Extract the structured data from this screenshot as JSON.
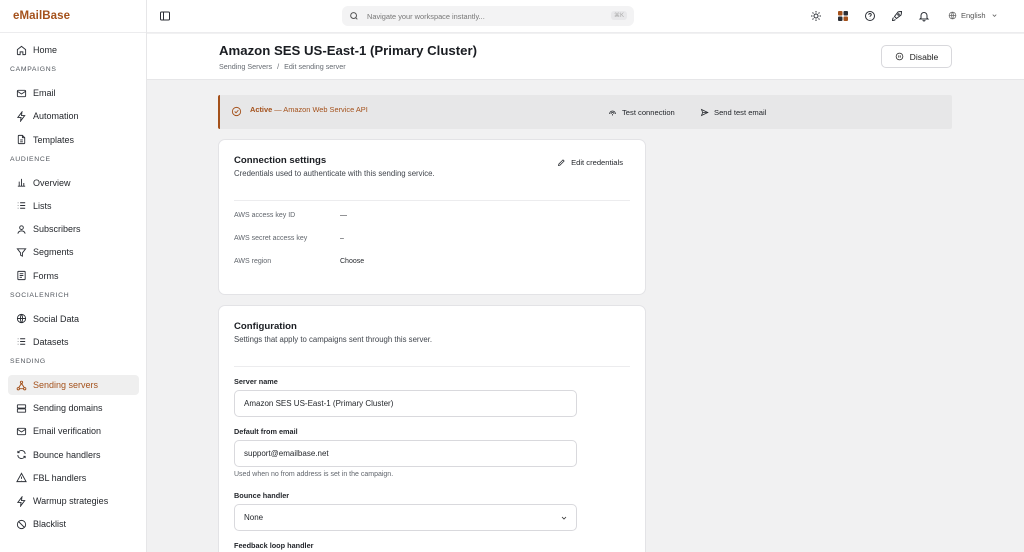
{
  "brand": "eMailBase",
  "search": {
    "placeholder": "Navigate your workspace instantly...",
    "shortcut": "⌘K"
  },
  "language": "English",
  "sidebar": {
    "home": "Home",
    "sections": {
      "campaigns": "CAMPAIGNS",
      "audience": "AUDIENCE",
      "socialenrich": "SOCIALENRICH",
      "sending": "SENDING"
    },
    "campaigns": [
      "Email",
      "Automation",
      "Templates"
    ],
    "audience": [
      "Overview",
      "Lists",
      "Subscribers",
      "Segments",
      "Forms"
    ],
    "socialenrich": [
      "Social Data",
      "Datasets"
    ],
    "sending": [
      "Sending servers",
      "Sending domains",
      "Email verification",
      "Bounce handlers",
      "FBL handlers",
      "Warmup strategies",
      "Blacklist"
    ]
  },
  "header": {
    "title": "Amazon SES US-East-1 (Primary Cluster)",
    "breadcrumb": [
      "Sending Servers",
      "Edit sending server"
    ],
    "breadcrumb_sep": "/",
    "disable_label": "Disable"
  },
  "status": {
    "state": "Active",
    "detail": " — Amazon Web Service API",
    "test_connection": "Test connection",
    "send_test_email": "Send test email"
  },
  "connection": {
    "title": "Connection settings",
    "subtitle": "Credentials used to authenticate with this sending service.",
    "edit_label": "Edit credentials",
    "rows": [
      {
        "key": "AWS access key ID",
        "value": "—"
      },
      {
        "key": "AWS secret access key",
        "value": "–"
      },
      {
        "key": "AWS region",
        "value": "Choose"
      }
    ]
  },
  "configuration": {
    "title": "Configuration",
    "subtitle": "Settings that apply to campaigns sent through this server.",
    "server_name_label": "Server name",
    "server_name_value": "Amazon SES US-East-1 (Primary Cluster)",
    "from_email_label": "Default from email",
    "from_email_value": "support@emailbase.net",
    "from_email_hint": "Used when no from address is set in the campaign.",
    "bounce_label": "Bounce handler",
    "bounce_value": "None",
    "fbl_label": "Feedback loop handler"
  },
  "colors": {
    "accent": "#a4511b",
    "background": "#f1f1f2",
    "status_bg": "#e7e7e8"
  }
}
